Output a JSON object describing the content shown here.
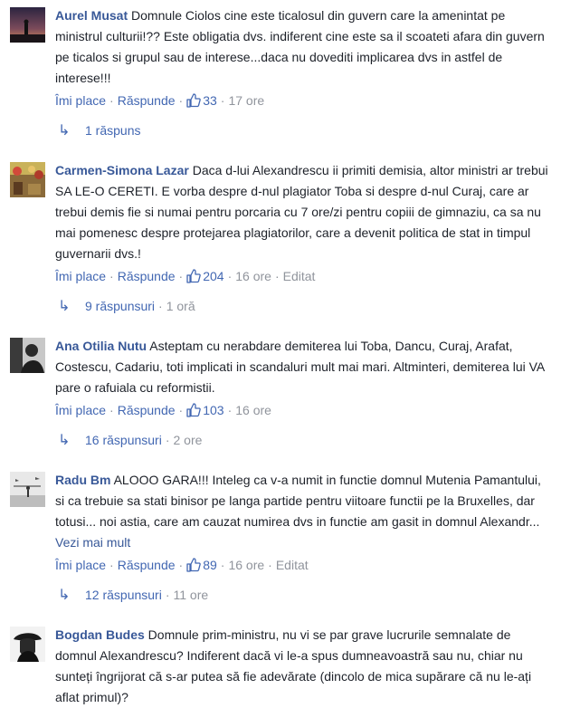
{
  "ui": {
    "like": "Îmi place",
    "reply": "Răspunde",
    "dot": "·"
  },
  "comments": [
    {
      "author": "Aurel Musat",
      "text": " Domnule Ciolos cine este ticalosul din guvern care la amenintat pe ministrul culturii!?? Este obligatia dvs. indiferent cine este sa il scoateti afara din guvern pe ticalos si grupul sau de interese...daca nu dovediti implicarea dvs in astfel de interese!!!",
      "likes": "33",
      "time": "17 ore",
      "edited": "",
      "replies": "1 răspuns",
      "replies_time": ""
    },
    {
      "author": "Carmen-Simona Lazar",
      "text": " Daca d-lui Alexandrescu ii primiti demisia, altor ministri ar trebui SA LE-O CERETI. E vorba despre d-nul plagiator Toba si despre d-nul Curaj, care ar trebui demis fie si numai pentru porcaria cu 7 ore/zi pentru copiii de gimnaziu, ca sa nu mai pomenesc despre protejarea plagiatorilor, care a devenit politica de stat in timpul guvernarii dvs.!",
      "likes": "204",
      "time": "16 ore",
      "edited": "Editat",
      "replies": "9 răspunsuri",
      "replies_time": "1 oră"
    },
    {
      "author": "Ana Otilia Nutu",
      "text": " Asteptam cu nerabdare demiterea lui Toba, Dancu, Curaj, Arafat, Costescu, Cadariu, toti implicati in scandaluri mult mai mari. Altminteri, demiterea lui VA pare o rafuiala cu reformistii.",
      "likes": "103",
      "time": "16 ore",
      "edited": "",
      "replies": "16 răspunsuri",
      "replies_time": "2 ore"
    },
    {
      "author": "Radu Bm",
      "text": " ALOOO GARA!!! Inteleg ca v-a numit in functie domnul Mutenia Pamantului, si ca trebuie sa stati binisor pe langa partide pentru viitoare functii pe la Bruxelles, dar totusi... noi astia, care am cauzat numirea dvs in functie am gasit in domnul Alexandr... ",
      "more": "Vezi mai mult",
      "likes": "89",
      "time": "16 ore",
      "edited": "Editat",
      "replies": "12 răspunsuri",
      "replies_time": "11 ore"
    },
    {
      "author": "Bogdan Budes",
      "text": " Domnule prim-ministru, nu vi se par grave lucrurile semnalate de domnul Alexandrescu? Indiferent dacă vi le-a spus dumneavoastră sau nu, chiar nu sunteți îngrijorat că s-ar putea să fie adevărate (dincolo de mica supărare că nu le-ați aflat primul)?"
    }
  ],
  "colors": {
    "link": "#4267b2",
    "author": "#385898",
    "meta": "#90949c",
    "text": "#1d2129"
  },
  "icons": {
    "like": "thumbs-up-icon",
    "reply_arrow": "reply-arrow-icon"
  }
}
